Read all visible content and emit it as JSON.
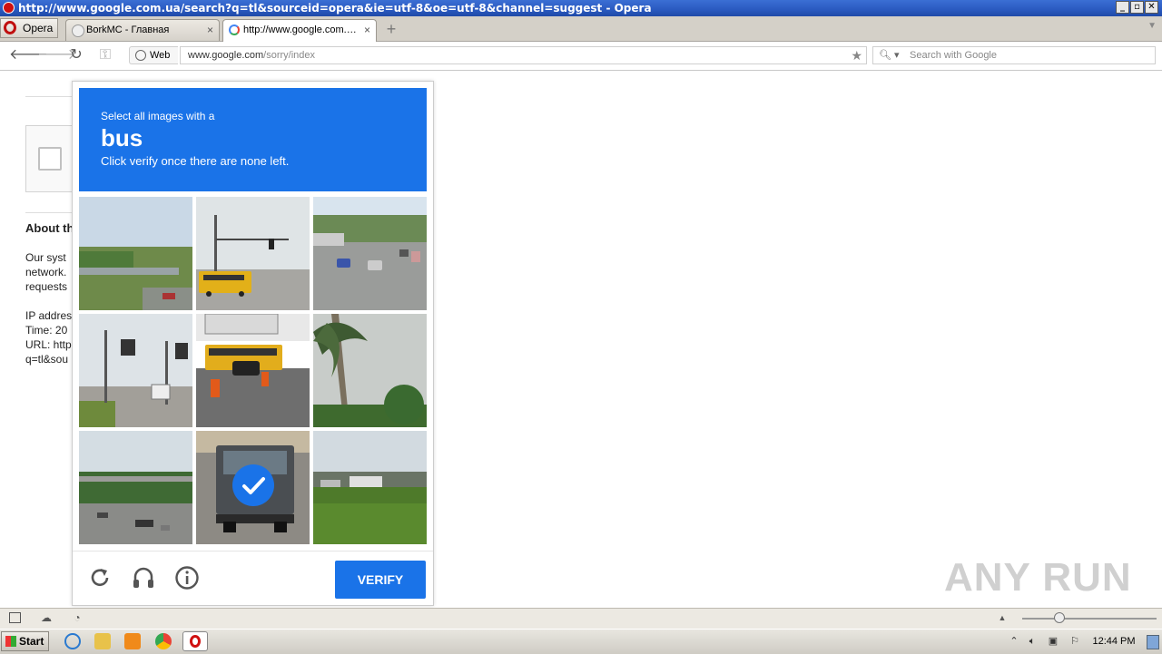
{
  "window": {
    "title": "http://www.google.com.ua/search?q=tl&sourceid=opera&ie=utf-8&oe=utf-8&channel=suggest - Opera",
    "controls": {
      "minimize": "_",
      "restore": "▫",
      "close": "✕"
    }
  },
  "browser": {
    "menu_label": "Opera",
    "tabs": [
      {
        "label": "BorkMC - Главная",
        "close": "×"
      },
      {
        "label": "http://www.google.com.ua/...",
        "close": "×"
      }
    ],
    "new_tab": "+",
    "address": {
      "mode_label": "Web",
      "url_domain": "www.google.com",
      "url_path": "/sorry/index"
    },
    "search": {
      "placeholder": "Search with Google"
    }
  },
  "page": {
    "heading": "About th",
    "para_lines": [
      "Our syst",
      "network.",
      "requests"
    ],
    "info_lines": [
      "IP addres",
      "Time: 20",
      "URL: http",
      "q=tl&sou"
    ]
  },
  "captcha": {
    "line1": "Select all images with a",
    "target": "bus",
    "line3": "Click verify once there are none left.",
    "selected_tiles": [
      7
    ],
    "verify_label": "VERIFY",
    "footer_icons": [
      "reload-icon",
      "audio-icon",
      "info-icon"
    ]
  },
  "watermark": "ANY RUN",
  "taskbar": {
    "start_label": "Start",
    "clock": "12:44 PM"
  }
}
